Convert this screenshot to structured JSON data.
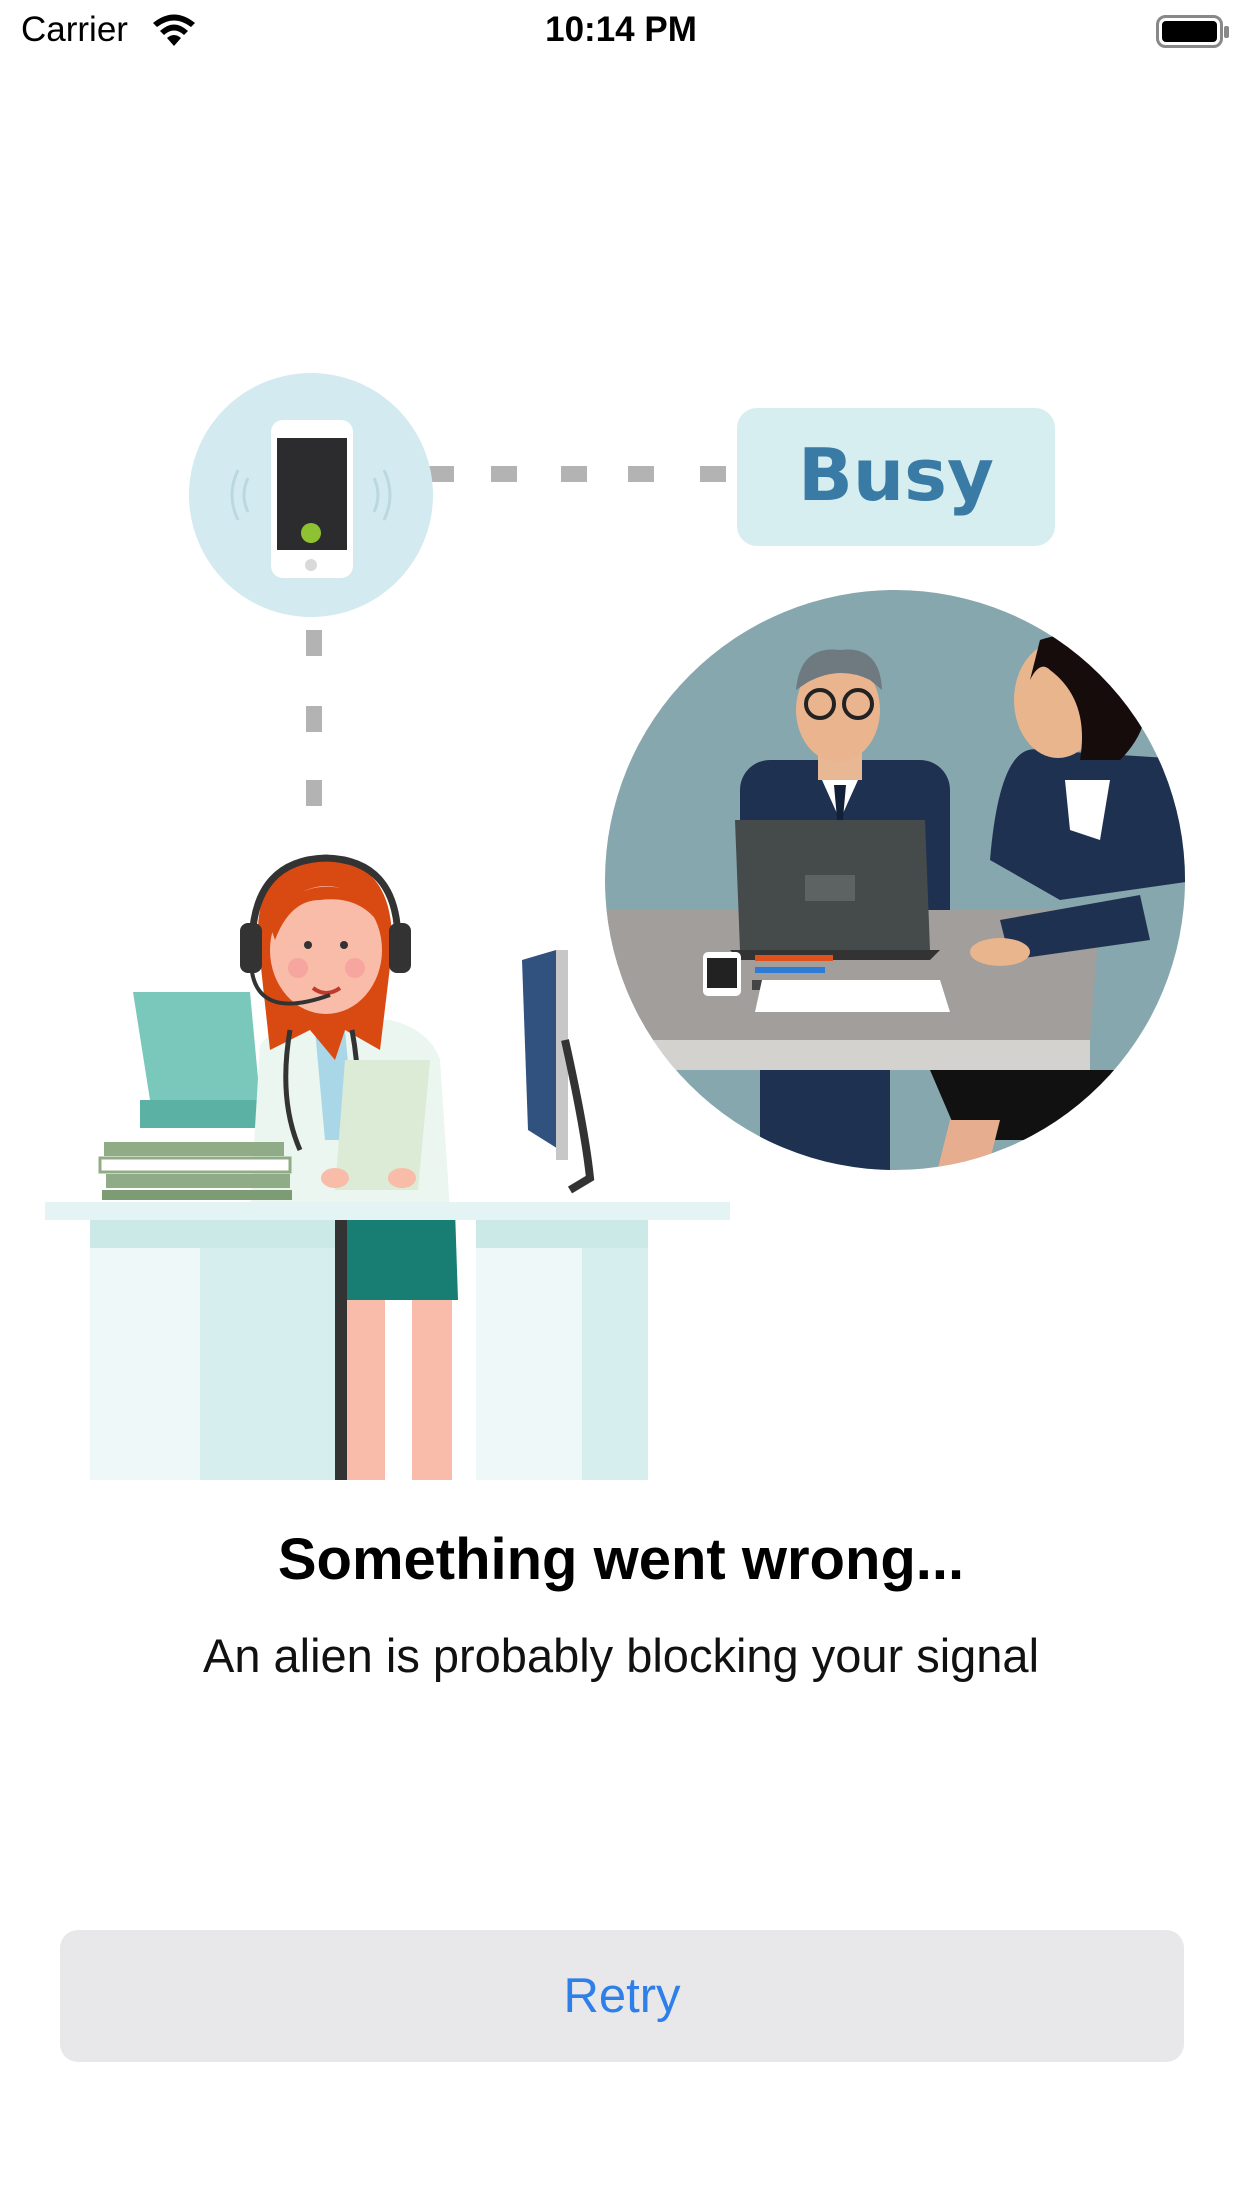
{
  "status_bar": {
    "carrier": "Carrier",
    "time": "10:14 PM",
    "icons": [
      "wifi-icon",
      "battery-icon"
    ]
  },
  "illustration": {
    "busy_label": "Busy",
    "colors": {
      "bubble": "#d3eaf0",
      "busy_text": "#3a7ba6",
      "room_wall": "#86a7ad",
      "desk": "#e4f4f5",
      "hair": "#d94a12",
      "suit": "#1f3150"
    }
  },
  "error": {
    "title": "Something went wrong...",
    "message": "An alien is probably blocking your signal"
  },
  "retry": {
    "label": "Retry",
    "accent": "#2f7fe9"
  }
}
